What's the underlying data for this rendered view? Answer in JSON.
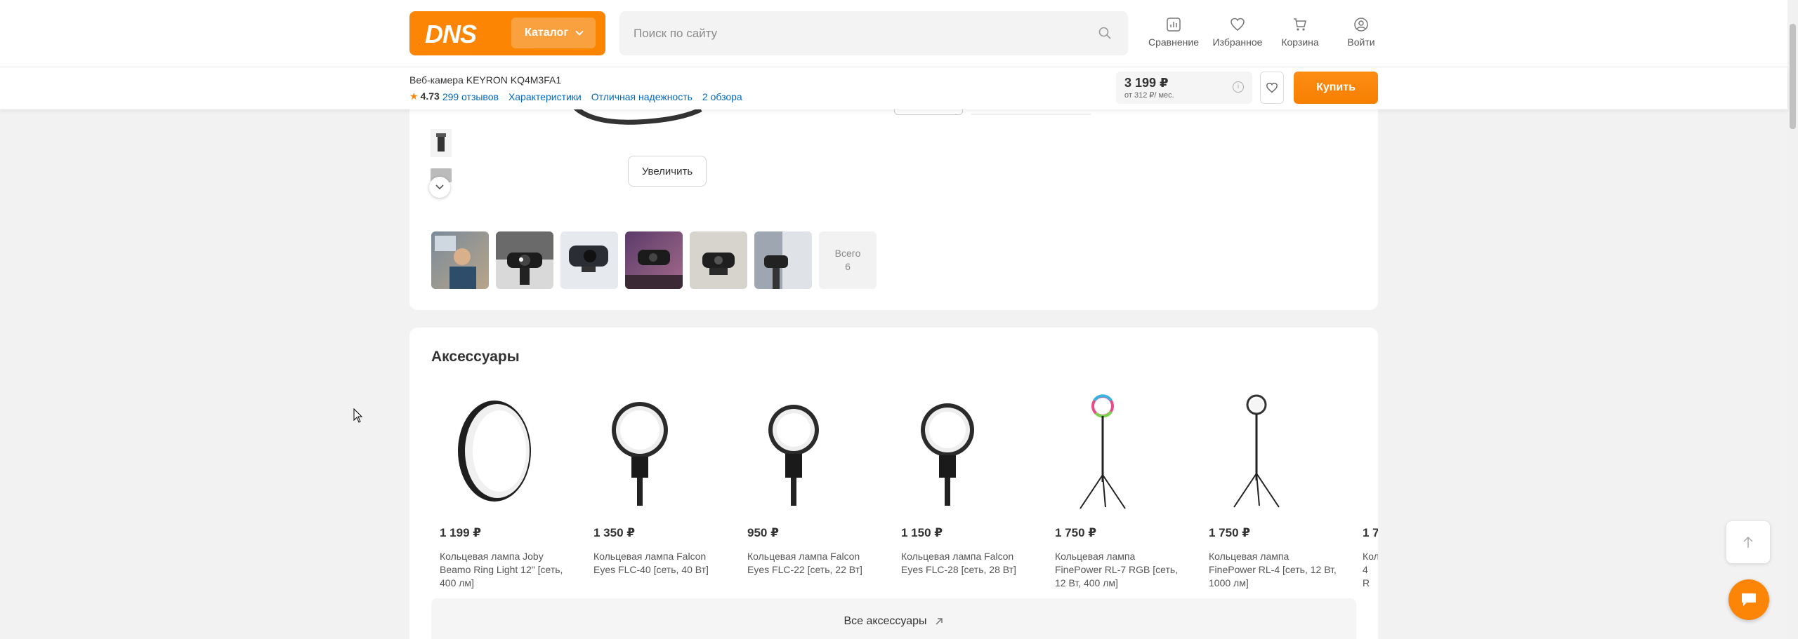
{
  "header": {
    "logo": "DNS",
    "catalog_label": "Каталог",
    "search_placeholder": "Поиск по сайту",
    "nav": [
      {
        "label": "Сравнение",
        "icon": "compare-icon"
      },
      {
        "label": "Избранное",
        "icon": "heart-icon"
      },
      {
        "label": "Корзина",
        "icon": "cart-icon"
      },
      {
        "label": "Войти",
        "icon": "user-icon"
      }
    ]
  },
  "product_bar": {
    "title": "Веб-камера KEYRON KQ4M3FA1",
    "rating": "4.73",
    "reviews_link": "299 отзывов",
    "links": [
      "Характеристики",
      "Отличная надежность",
      "2 обзора"
    ],
    "price": "3 199 ₽",
    "installment": "от 312 ₽/ мес.",
    "buy_label": "Купить"
  },
  "gallery": {
    "zoom_label": "Увеличить",
    "total_label": "Всего",
    "total_count": "6"
  },
  "accessories": {
    "title": "Аксессуары",
    "items": [
      {
        "price": "1 199 ₽",
        "name": "Кольцевая лампа Joby Beamo Ring Light 12\" [сеть, 400 лм]"
      },
      {
        "price": "1 350 ₽",
        "name": "Кольцевая лампа Falcon Eyes FLC-40 [сеть, 40 Вт]"
      },
      {
        "price": "950 ₽",
        "name": "Кольцевая лампа Falcon Eyes FLC-22 [сеть, 22 Вт]"
      },
      {
        "price": "1 150 ₽",
        "name": "Кольцевая лампа Falcon Eyes FLC-28 [сеть, 28 Вт]"
      },
      {
        "price": "1 750 ₽",
        "name": "Кольцевая лампа FinePower RL-7 RGB [сеть, 12 Вт, 400 лм]"
      },
      {
        "price": "1 750 ₽",
        "name": "Кольцевая лампа FinePower RL-4 [сеть, 12 Вт, 1000 лм]"
      },
      {
        "price": "1 7",
        "name": "Коль 4 R"
      }
    ],
    "all_label": "Все аксессуары"
  },
  "colors": {
    "accent": "#fc8507",
    "link": "#0069c2"
  }
}
